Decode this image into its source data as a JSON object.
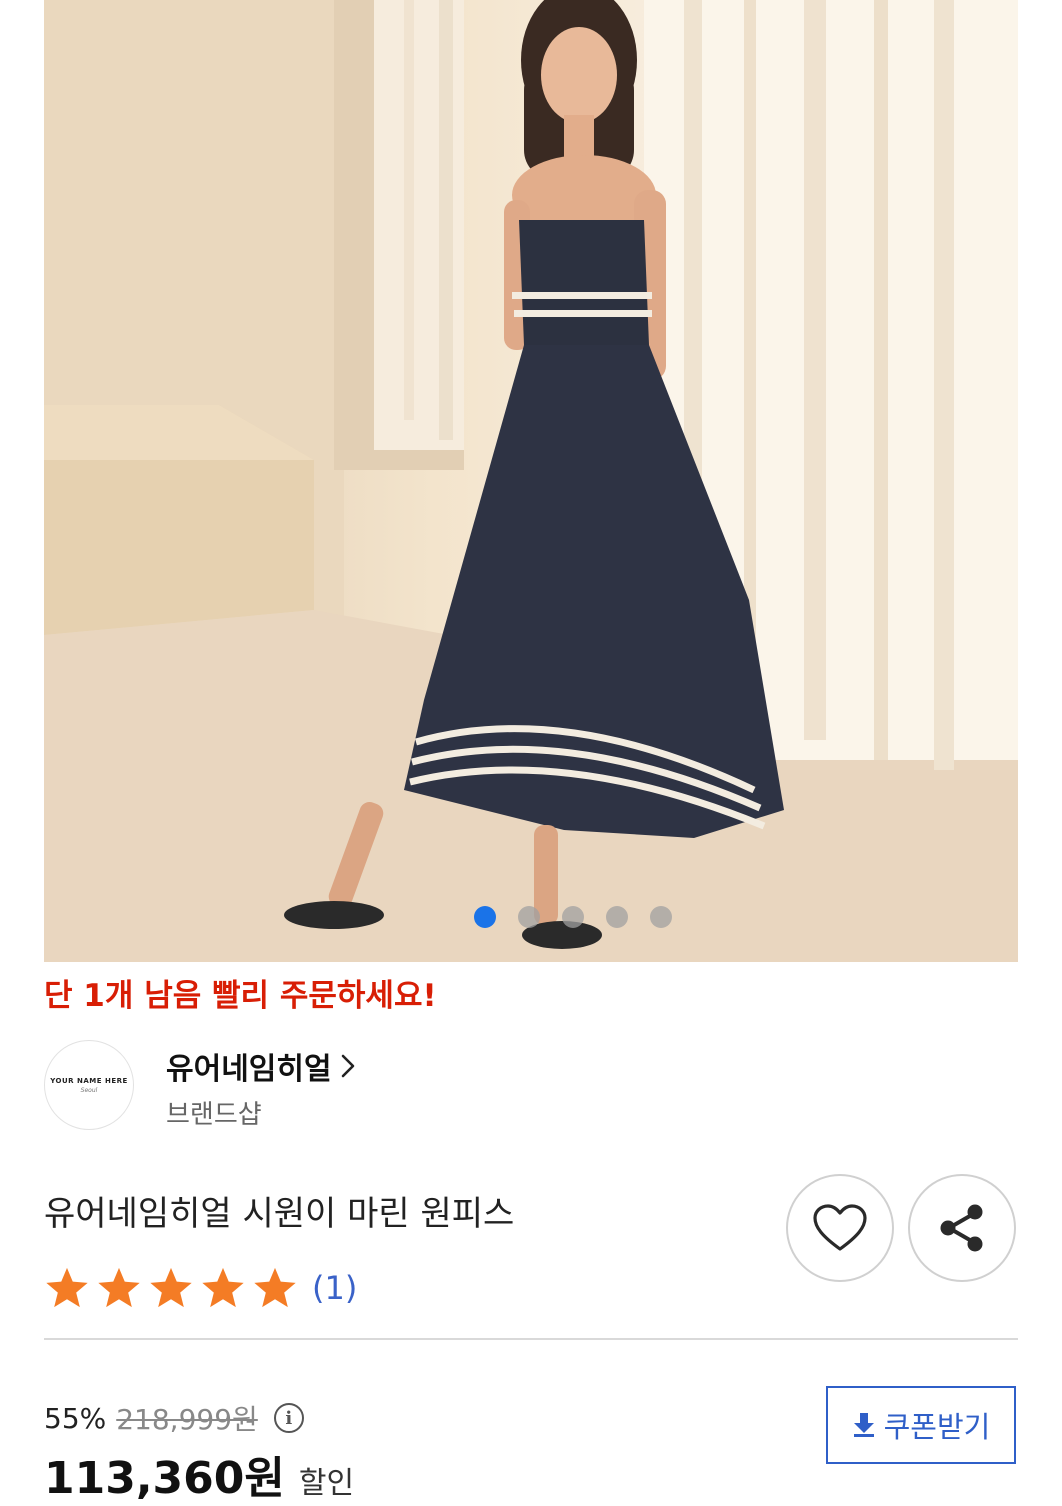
{
  "gallery": {
    "slide_count": 5,
    "active_index": 0,
    "image_alt": "product photo of model wearing navy sailor-stripe dress"
  },
  "stock_notice": "단 1개 남음 빨리 주문하세요!",
  "brand": {
    "logo_line1": "YOUR NAME HERE",
    "logo_line2": "Seoul",
    "name": "유어네임히얼",
    "chevron": "›",
    "sub": "브랜드샵"
  },
  "product": {
    "title": "유어네임히얼 시원이 마린 원피스",
    "like_icon": "heart-outline-icon",
    "share_icon": "share-icon"
  },
  "rating": {
    "stars": 5,
    "max_stars": 5,
    "review_count": "(1)",
    "star_color": "#f47c25"
  },
  "price": {
    "discount_rate": "55%",
    "original_price": "218,999원",
    "info_icon": "i",
    "sale_price": "113,360원",
    "sale_label": "할인"
  },
  "coupon": {
    "label": "쿠폰받기",
    "icon": "download-icon"
  },
  "colors": {
    "accent_blue": "#1a73e8",
    "alert_red": "#d81e05",
    "coupon_blue": "#2f5fc8"
  }
}
